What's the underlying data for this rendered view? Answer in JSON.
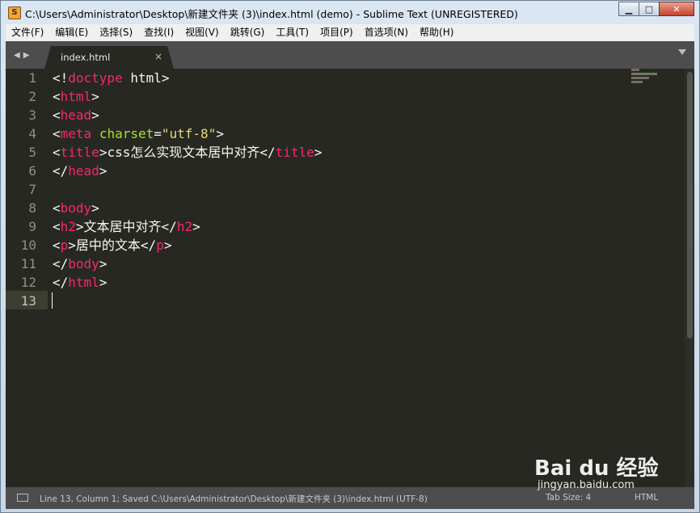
{
  "window": {
    "title": "C:\\Users\\Administrator\\Desktop\\新建文件夹 (3)\\index.html (demo) - Sublime Text (UNREGISTERED)",
    "icon": "sublime-text-icon"
  },
  "menu": [
    "文件(F)",
    "编辑(E)",
    "选择(S)",
    "查找(I)",
    "视图(V)",
    "跳转(G)",
    "工具(T)",
    "项目(P)",
    "首选项(N)",
    "帮助(H)"
  ],
  "tabs": [
    {
      "label": "index.html",
      "close": "×",
      "active": true
    }
  ],
  "editor": {
    "line_numbers": [
      "1",
      "2",
      "3",
      "4",
      "5",
      "6",
      "7",
      "8",
      "9",
      "10",
      "11",
      "12",
      "13"
    ],
    "active_line": 13,
    "lines": [
      [
        {
          "t": "<!"
        },
        {
          "t": "doctype",
          "c": "tag"
        },
        {
          "t": " html>"
        }
      ],
      [
        {
          "t": "<"
        },
        {
          "t": "html",
          "c": "tag"
        },
        {
          "t": ">"
        }
      ],
      [
        {
          "t": "<"
        },
        {
          "t": "head",
          "c": "tag"
        },
        {
          "t": ">"
        }
      ],
      [
        {
          "t": "<"
        },
        {
          "t": "meta",
          "c": "tag"
        },
        {
          "t": " "
        },
        {
          "t": "charset",
          "c": "attr"
        },
        {
          "t": "="
        },
        {
          "t": "\"utf-8\"",
          "c": "str"
        },
        {
          "t": ">"
        }
      ],
      [
        {
          "t": "<"
        },
        {
          "t": "title",
          "c": "tag"
        },
        {
          "t": ">css怎么实现文本居中对齐</"
        },
        {
          "t": "title",
          "c": "tag"
        },
        {
          "t": ">"
        }
      ],
      [
        {
          "t": "</"
        },
        {
          "t": "head",
          "c": "tag"
        },
        {
          "t": ">"
        }
      ],
      [],
      [
        {
          "t": "<"
        },
        {
          "t": "body",
          "c": "tag"
        },
        {
          "t": ">"
        }
      ],
      [
        {
          "t": "<"
        },
        {
          "t": "h2",
          "c": "tag"
        },
        {
          "t": ">文本居中对齐</"
        },
        {
          "t": "h2",
          "c": "tag"
        },
        {
          "t": ">"
        }
      ],
      [
        {
          "t": "<"
        },
        {
          "t": "p",
          "c": "tag"
        },
        {
          "t": ">居中的文本</"
        },
        {
          "t": "p",
          "c": "tag"
        },
        {
          "t": ">"
        }
      ],
      [
        {
          "t": "</"
        },
        {
          "t": "body",
          "c": "tag"
        },
        {
          "t": ">"
        }
      ],
      [
        {
          "t": "</"
        },
        {
          "t": "html",
          "c": "tag"
        },
        {
          "t": ">"
        }
      ],
      []
    ]
  },
  "status": {
    "text": "Line 13, Column 1; Saved C:\\Users\\Administrator\\Desktop\\新建文件夹 (3)\\index.html (UTF-8)",
    "tab_size": "Tab Size: 4",
    "syntax": "HTML"
  },
  "watermark": {
    "logo": "Bai du 经验",
    "url": "jingyan.baidu.com"
  },
  "colors": {
    "editor_bg": "#272822",
    "tag": "#f92672",
    "attr": "#a6e22e",
    "string": "#e6db74",
    "text": "#f8f8f2",
    "chrome": "#4d4d4d"
  }
}
